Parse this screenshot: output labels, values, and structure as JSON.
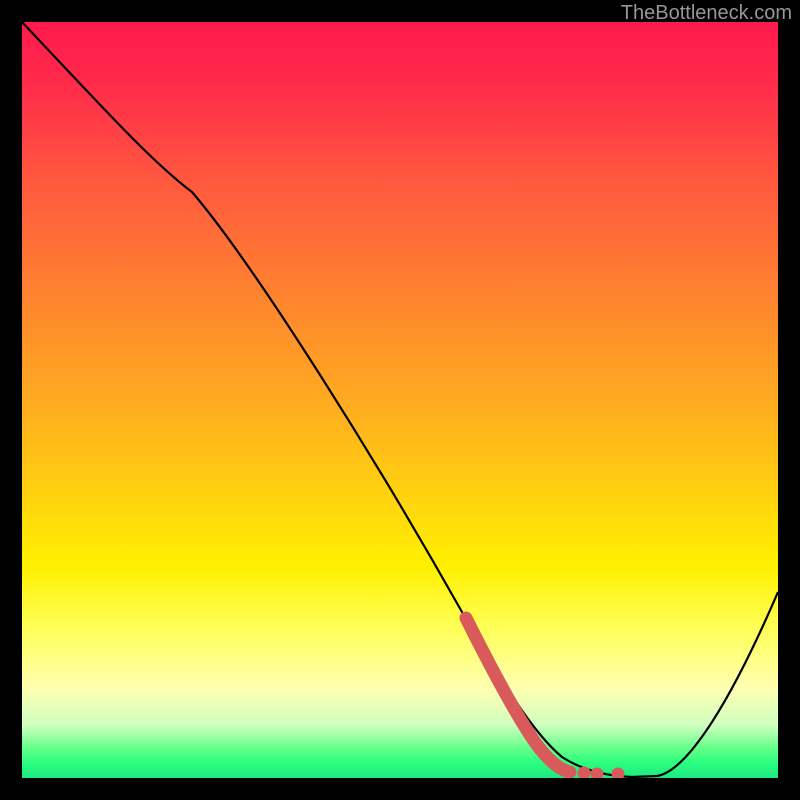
{
  "attribution": "TheBottleneck.com",
  "chart_data": {
    "type": "line",
    "title": "",
    "xlabel": "",
    "ylabel": "",
    "xlim": [
      0,
      100
    ],
    "ylim": [
      0,
      100
    ],
    "series": [
      {
        "name": "curve",
        "color": "#000000",
        "points": [
          {
            "x": 0,
            "y": 100
          },
          {
            "x": 22,
            "y": 78
          },
          {
            "x": 60,
            "y": 18
          },
          {
            "x": 68,
            "y": 4
          },
          {
            "x": 78,
            "y": 0
          },
          {
            "x": 82,
            "y": 0
          },
          {
            "x": 100,
            "y": 28
          }
        ]
      },
      {
        "name": "highlight",
        "color": "#d85a5a",
        "points": [
          {
            "x": 60,
            "y": 18
          },
          {
            "x": 64,
            "y": 10
          },
          {
            "x": 67,
            "y": 5
          },
          {
            "x": 69,
            "y": 3
          },
          {
            "x": 71,
            "y": 2
          },
          {
            "x": 73,
            "y": 1.5
          },
          {
            "x": 76,
            "y": 1
          },
          {
            "x": 78,
            "y": 1
          }
        ]
      }
    ],
    "background_gradient": {
      "top": "#ff1a4d",
      "mid_upper": "#ffaa20",
      "mid": "#fff000",
      "mid_lower": "#ffffb0",
      "bottom": "#1de880"
    }
  }
}
